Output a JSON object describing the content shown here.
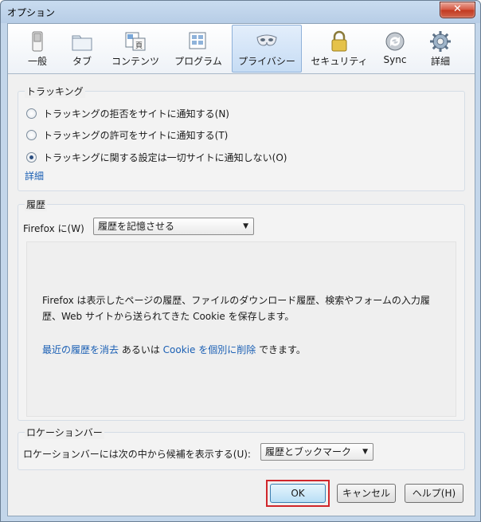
{
  "window": {
    "title": "オプション",
    "close_glyph": "✕"
  },
  "toolbar": {
    "panes": [
      {
        "label": "一般",
        "icon": "switch-icon"
      },
      {
        "label": "タブ",
        "icon": "tabs-folder-icon"
      },
      {
        "label": "コンテンツ",
        "icon": "content-page-icon"
      },
      {
        "label": "プログラム",
        "icon": "applications-icon"
      },
      {
        "label": "プライバシー",
        "icon": "privacy-mask-icon",
        "selected": true
      },
      {
        "label": "セキュリティ",
        "icon": "padlock-icon"
      },
      {
        "label": "Sync",
        "icon": "sync-icon"
      },
      {
        "label": "詳細",
        "icon": "gear-icon"
      }
    ]
  },
  "tracking": {
    "group_label": "トラッキング",
    "options": [
      {
        "label": "トラッキングの拒否をサイトに通知する(N)",
        "checked": false
      },
      {
        "label": "トラッキングの許可をサイトに通知する(T)",
        "checked": false
      },
      {
        "label": "トラッキングに関する設定は一切サイトに通知しない(O)",
        "checked": true
      }
    ],
    "details_link": "詳細"
  },
  "history": {
    "group_label": "履歴",
    "firefox_label": "Firefox に(W)",
    "mode_selected": "履歴を記憶させる",
    "description_line1": "Firefox は表示したページの履歴、ファイルのダウンロード履歴、検索やフォームの入力履",
    "description_line2": "歴、Web サイトから送られてきた Cookie を保存します。",
    "clear_link": "最近の履歴を消去",
    "or_text": " あるいは ",
    "cookie_link": "Cookie を個別に削除",
    "tail_text": " できます。"
  },
  "location_bar": {
    "group_label": "ロケーションバー",
    "suggest_label": "ロケーションバーには次の中から候補を表示する(U):",
    "suggest_selected": "履歴とブックマーク"
  },
  "buttons": {
    "ok": "OK",
    "cancel": "キャンセル",
    "help": "ヘルプ(H)"
  },
  "colors": {
    "link": "#1a5fb4",
    "highlight": "#d0262b",
    "selected_pane": "#c6dcf4"
  }
}
